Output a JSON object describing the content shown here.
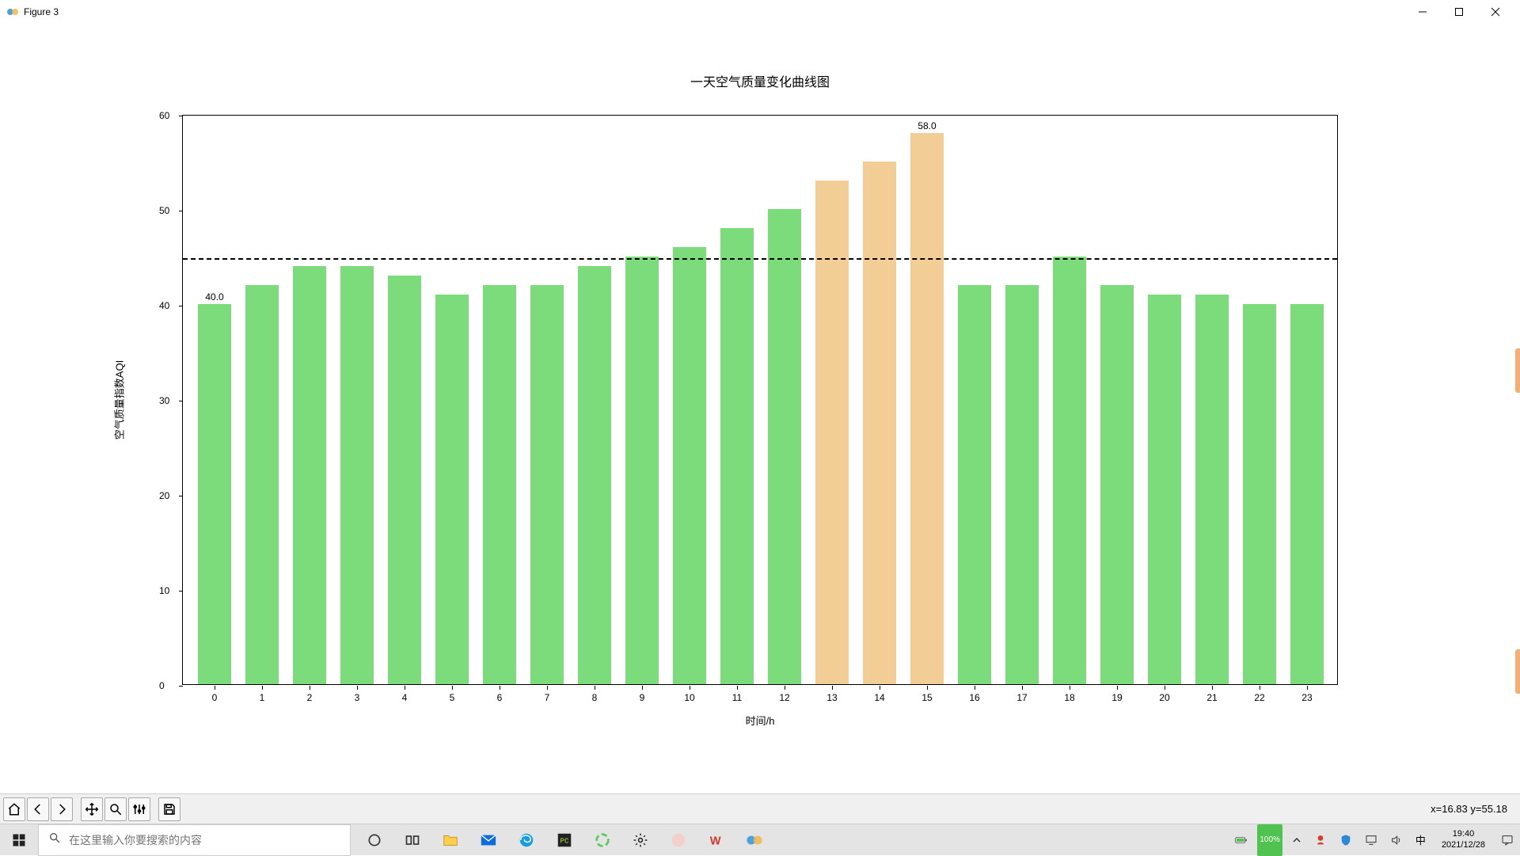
{
  "window": {
    "title": "Figure 3"
  },
  "chart_data": {
    "type": "bar",
    "title": "一天空气质量变化曲线图",
    "xlabel": "时间/h",
    "ylabel": "空气质量指数AQI",
    "ylim": [
      0,
      60
    ],
    "yticks": [
      0,
      10,
      20,
      30,
      40,
      50,
      60
    ],
    "categories": [
      "0",
      "1",
      "2",
      "3",
      "4",
      "5",
      "6",
      "7",
      "8",
      "9",
      "10",
      "11",
      "12",
      "13",
      "14",
      "15",
      "16",
      "17",
      "18",
      "19",
      "20",
      "21",
      "22",
      "23"
    ],
    "values": [
      40,
      42,
      44,
      44,
      43,
      41,
      42,
      42,
      44,
      45,
      46,
      48,
      50,
      53,
      55,
      58,
      42,
      42,
      45,
      42,
      41,
      41,
      40,
      40
    ],
    "colors": [
      "green",
      "green",
      "green",
      "green",
      "green",
      "green",
      "green",
      "green",
      "green",
      "green",
      "green",
      "green",
      "green",
      "orange",
      "orange",
      "orange",
      "green",
      "green",
      "green",
      "green",
      "green",
      "green",
      "green",
      "green"
    ],
    "hline": 45,
    "annotations": [
      {
        "index": 0,
        "text": "40.0"
      },
      {
        "index": 15,
        "text": "58.0"
      }
    ]
  },
  "coord_readout": "x=16.83 y=55.18",
  "search": {
    "placeholder": "在这里输入你要搜索的内容"
  },
  "battery": {
    "label": "100%"
  },
  "ime": {
    "label": "中"
  },
  "clock": {
    "time": "19:40",
    "date": "2021/12/28"
  }
}
